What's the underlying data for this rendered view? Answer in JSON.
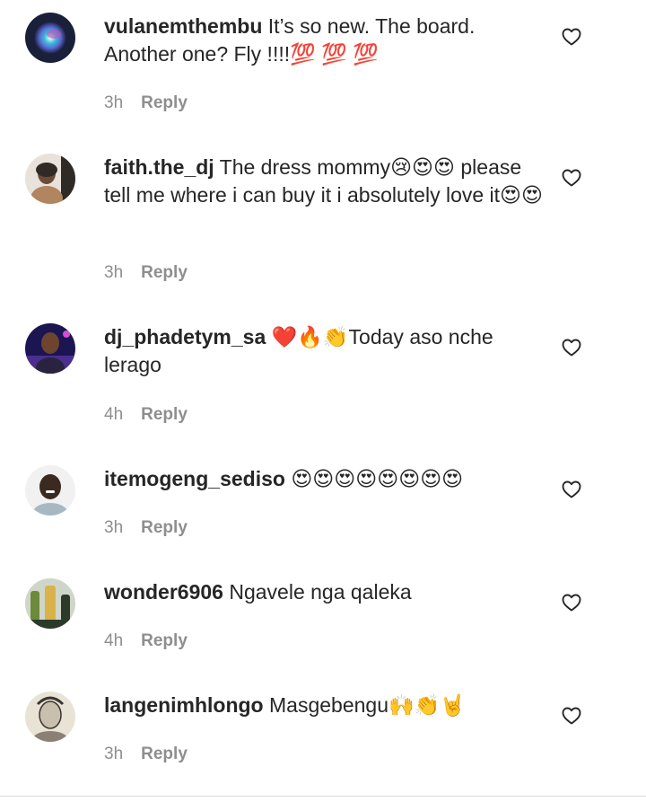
{
  "comments": [
    {
      "username": "vulanemthembu",
      "text": " It’s so new. The board. Another one? Fly !!!!💯 💯 💯",
      "time": "3h",
      "reply": "Reply",
      "avatar": "siri-orb-avatar",
      "avatar_colors": [
        "#1a1f3a",
        "#5a6ad6",
        "#c84fb6",
        "#3ac0d8"
      ]
    },
    {
      "username": "faith.the_dj",
      "text": " The dress mommy😢😍😍 please tell me where i can buy it i absolutely love it😍😍",
      "time": "3h",
      "reply": "Reply",
      "avatar": "portrait-avatar",
      "avatar_colors": [
        "#e8e2da",
        "#6b4a36",
        "#b0855f",
        "#2f2a26"
      ]
    },
    {
      "username": "dj_phadetym_sa",
      "text": " ❤️🔥👏Today aso nche lerago",
      "time": "4h",
      "reply": "Reply",
      "avatar": "dj-avatar",
      "avatar_colors": [
        "#1b1552",
        "#4a2f8e",
        "#6d4430",
        "#d04fd8"
      ]
    },
    {
      "username": "itemogeng_sediso",
      "text": " 😍😍😍😍😍😍😍😍",
      "time": "3h",
      "reply": "Reply",
      "avatar": "smiling-man-avatar",
      "avatar_colors": [
        "#f1f1f1",
        "#3b2a20",
        "#ffffff",
        "#a7b8c4"
      ]
    },
    {
      "username": "wonder6906",
      "text": " Ngavele nga qaleka",
      "time": "4h",
      "reply": "Reply",
      "avatar": "drinks-avatar",
      "avatar_colors": [
        "#cfd6c9",
        "#6b8a3a",
        "#d9b24a",
        "#2c3a2a"
      ]
    },
    {
      "username": "langenimhlongo",
      "text": " Masgebengu🙌👏🤘",
      "time": "3h",
      "reply": "Reply",
      "avatar": "sketch-avatar",
      "avatar_colors": [
        "#e9e3d6",
        "#3a3530",
        "#8b8073",
        "#c9bfae"
      ]
    }
  ],
  "colors": {
    "text": "#262626",
    "secondary": "#8e8e8e",
    "heart_stroke": "#262626",
    "divider": "#dbdbdb"
  },
  "icons": {
    "like": "heart-outline-icon"
  }
}
